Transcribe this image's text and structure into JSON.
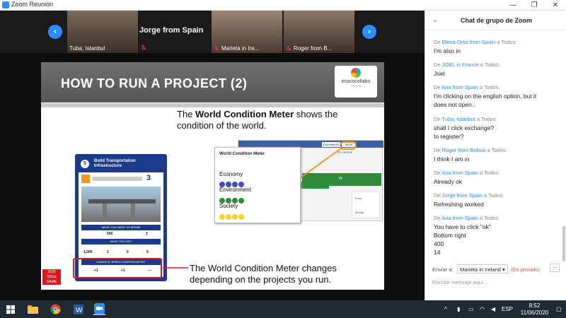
{
  "window": {
    "title": "Zoom Reunión"
  },
  "video_strip": {
    "speaker": "Jorge from Spain",
    "participants": [
      {
        "name": "Tuba, Istanbul"
      },
      {
        "name": "Marieta in Ire..."
      },
      {
        "name": "Roger from B..."
      }
    ]
  },
  "slide": {
    "title": "HOW TO RUN A PROJECT (2)",
    "logo": {
      "name": "imacocollabo",
      "sub": "COCOA"
    },
    "line1_pre": "The ",
    "line1_bold": "World Condition Meter",
    "line1_post": " shows the",
    "line2": "condition of the world.",
    "bottom_line1": "The World Condition Meter changes",
    "bottom_line2": "depending on the projects you run.",
    "card": {
      "number": "5",
      "title_line1": "Build Transportation",
      "title_line2": "Infrastructure",
      "tag_number": "3",
      "spend_label": "WHAT YOU NEED TO SPEND",
      "spend_money": "500",
      "spend_time": "3",
      "get_label": "WHAT YOU GET",
      "get_money": "1,000",
      "get_time": "1",
      "get_project": "0",
      "get_renewable": "0",
      "change_label": "CHANGE IN \"WORLD CONDITION METER\"",
      "change_1": "+1",
      "change_2": "+1",
      "change_3": "---"
    },
    "meter": {
      "title": "World Condition Meter",
      "sections": [
        {
          "label": "Economy",
          "color": "#3b4fc0"
        },
        {
          "label": "Environment",
          "color": "#2e8b3a"
        },
        {
          "label": "Society",
          "color": "#f2d22e"
        }
      ]
    },
    "game_ui": {
      "btn_exchange": "EXCHANGE",
      "btn_wcm": "WCM",
      "label_office": "EX OFFICE",
      "label_in": "IN",
      "label_from": "From",
      "label_money": "Money"
    },
    "badge": "2030\nSDGs\nGAME"
  },
  "chat": {
    "title": "Chat de grupo de Zoom",
    "prefix": "De ",
    "suffix": " a Todos:",
    "messages": [
      {
        "from": "Elena Ortiz from Spain",
        "lines": [
          "I'm also in"
        ]
      },
      {
        "from": "JOEL in France",
        "lines": [
          "Joel"
        ]
      },
      {
        "from": "Ana from Spain",
        "lines": [
          "I'm clicking on the english option, but it",
          "does not open.."
        ]
      },
      {
        "from": "Tuba, Istanbul",
        "lines": [
          "shall I click exchange?",
          "to register?"
        ]
      },
      {
        "from": "Roger from Bolivia",
        "lines": [
          "I think I am in"
        ]
      },
      {
        "from": "Ana from Spain",
        "lines": [
          "Already ok"
        ]
      },
      {
        "from": "Jorge from Spain",
        "lines": [
          "Refreshing worked"
        ]
      },
      {
        "from": "Ana from Spain",
        "lines": [
          "You have to click \"ok\"",
          "Bottom right",
          "400",
          "14"
        ]
      }
    ],
    "send_to_label": "Enviar a:",
    "send_to_value": "Marieta in Ireland",
    "private_label": "(En privado)",
    "input_placeholder": "Escribir mensaje aquí..."
  },
  "taskbar": {
    "time": "8:52",
    "date": "11/06/2020",
    "tray": "ESP",
    "apps": [
      "windows-start",
      "file-explorer",
      "chrome",
      "word",
      "zoom"
    ]
  }
}
